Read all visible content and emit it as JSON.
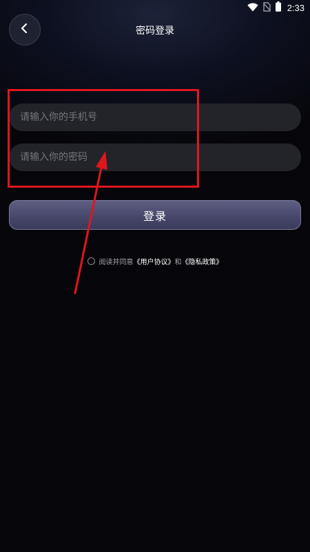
{
  "status_bar": {
    "time": "2:33",
    "icons": [
      "wifi-icon",
      "no-sim-icon",
      "battery-icon"
    ]
  },
  "header": {
    "back_icon": "chevron-left-icon",
    "title": "密码登录"
  },
  "form": {
    "phone_placeholder": "请输入你的手机号",
    "password_placeholder": "请输入你的密码"
  },
  "login_button": {
    "label": "登录"
  },
  "agreement": {
    "prefix": "阅读并同意",
    "user_agreement": "《用户协议》",
    "conjunction": "和",
    "privacy_policy": "《隐私政策》"
  },
  "colors": {
    "background": "#06060a",
    "input_background": "#23242a",
    "login_button": "#4e4e72",
    "annotation": "#e0161e"
  }
}
